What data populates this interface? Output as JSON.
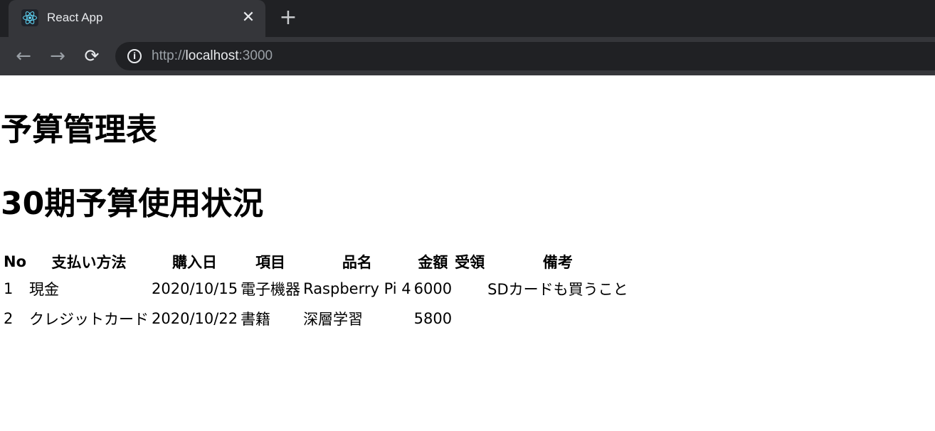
{
  "browser": {
    "tab_title": "React App",
    "tab_close_glyph": "✕",
    "new_tab_glyph": "+",
    "back_glyph": "←",
    "forward_glyph": "→",
    "reload_glyph": "⟳",
    "info_glyph": "i",
    "url": {
      "scheme": "http://",
      "host": "localhost",
      "port": ":3000"
    }
  },
  "page": {
    "title": "予算管理表",
    "subtitle": "30期予算使用状況"
  },
  "table": {
    "headers": [
      "No",
      "支払い方法",
      "購入日",
      "項目",
      "品名",
      "金額",
      "受領",
      "備考"
    ],
    "rows": [
      [
        "1",
        "現金",
        "2020/10/15",
        "電子機器",
        "Raspberry Pi 4",
        "6000",
        "",
        "SDカードも買うこと"
      ],
      [
        "2",
        "クレジットカード",
        "2020/10/22",
        "書籍",
        "深層学習",
        "5800",
        "",
        ""
      ]
    ]
  },
  "icons": {
    "favicon": "react-logo-icon",
    "close": "close-icon",
    "new_tab": "plus-icon",
    "back": "arrow-left-icon",
    "forward": "arrow-right-icon",
    "reload": "reload-icon",
    "info": "info-icon"
  },
  "colors": {
    "chrome_dark": "#202124",
    "chrome_tab": "#35363a",
    "react_cyan": "#61dafb"
  }
}
